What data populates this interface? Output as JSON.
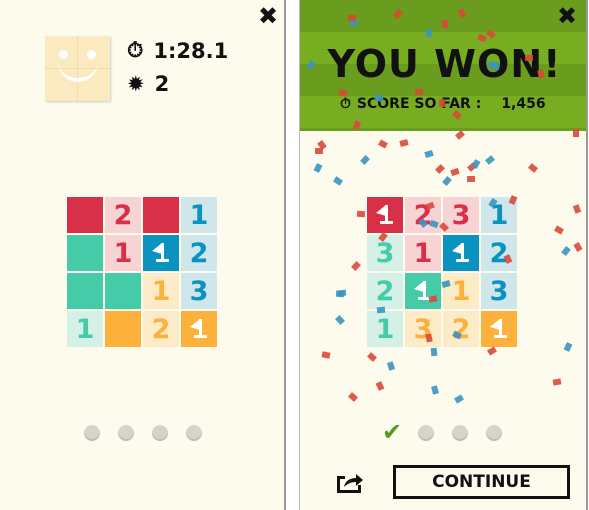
{
  "colors": {
    "red": "#d9304a",
    "red_light": "#f7d3d3",
    "teal": "#46cba9",
    "teal_light": "#d5f0e6",
    "blue": "#0a93c0",
    "blue_light": "#cfe6ea",
    "orange": "#fbb13c",
    "orange_light": "#fdebc8",
    "header_green": "#78ad22",
    "check_green": "#5a9a1a"
  },
  "left": {
    "close_icon": "close-icon",
    "timer": "1:28.1",
    "mines": "2",
    "grid": [
      [
        {
          "bg": "red"
        },
        {
          "bg": "red_light",
          "n": "2",
          "c": "red"
        },
        {
          "bg": "red"
        },
        {
          "bg": "blue_light",
          "n": "1",
          "c": "blue"
        }
      ],
      [
        {
          "bg": "teal"
        },
        {
          "bg": "red_light",
          "n": "1",
          "c": "red"
        },
        {
          "bg": "blue",
          "flag": true
        },
        {
          "bg": "blue_light",
          "n": "2",
          "c": "blue"
        }
      ],
      [
        {
          "bg": "teal"
        },
        {
          "bg": "teal"
        },
        {
          "bg": "orange_light",
          "n": "1",
          "c": "orange"
        },
        {
          "bg": "blue_light",
          "n": "3",
          "c": "blue"
        }
      ],
      [
        {
          "bg": "teal_light",
          "n": "1",
          "c": "teal"
        },
        {
          "bg": "orange"
        },
        {
          "bg": "orange_light",
          "n": "2",
          "c": "orange"
        },
        {
          "bg": "orange",
          "flag": true
        }
      ]
    ],
    "progress": [
      false,
      false,
      false,
      false
    ]
  },
  "right": {
    "title": "YOU WON!",
    "score_label": "SCORE SO FAR :",
    "score": "1,456",
    "continue_label": "CONTINUE",
    "grid": [
      [
        {
          "bg": "red",
          "flag": true
        },
        {
          "bg": "red_light",
          "n": "2",
          "c": "red"
        },
        {
          "bg": "red_light",
          "n": "3",
          "c": "red"
        },
        {
          "bg": "blue_light",
          "n": "1",
          "c": "blue"
        }
      ],
      [
        {
          "bg": "teal_light",
          "n": "3",
          "c": "teal"
        },
        {
          "bg": "red_light",
          "n": "1",
          "c": "red"
        },
        {
          "bg": "blue",
          "flag": true
        },
        {
          "bg": "blue_light",
          "n": "2",
          "c": "blue"
        }
      ],
      [
        {
          "bg": "teal_light",
          "n": "2",
          "c": "teal"
        },
        {
          "bg": "teal",
          "flag": true
        },
        {
          "bg": "orange_light",
          "n": "1",
          "c": "orange"
        },
        {
          "bg": "blue_light",
          "n": "3",
          "c": "blue"
        }
      ],
      [
        {
          "bg": "teal_light",
          "n": "1",
          "c": "teal"
        },
        {
          "bg": "orange_light",
          "n": "3",
          "c": "orange"
        },
        {
          "bg": "orange_light",
          "n": "2",
          "c": "orange"
        },
        {
          "bg": "orange",
          "flag": true
        }
      ]
    ],
    "progress": [
      true,
      false,
      false,
      false
    ]
  }
}
